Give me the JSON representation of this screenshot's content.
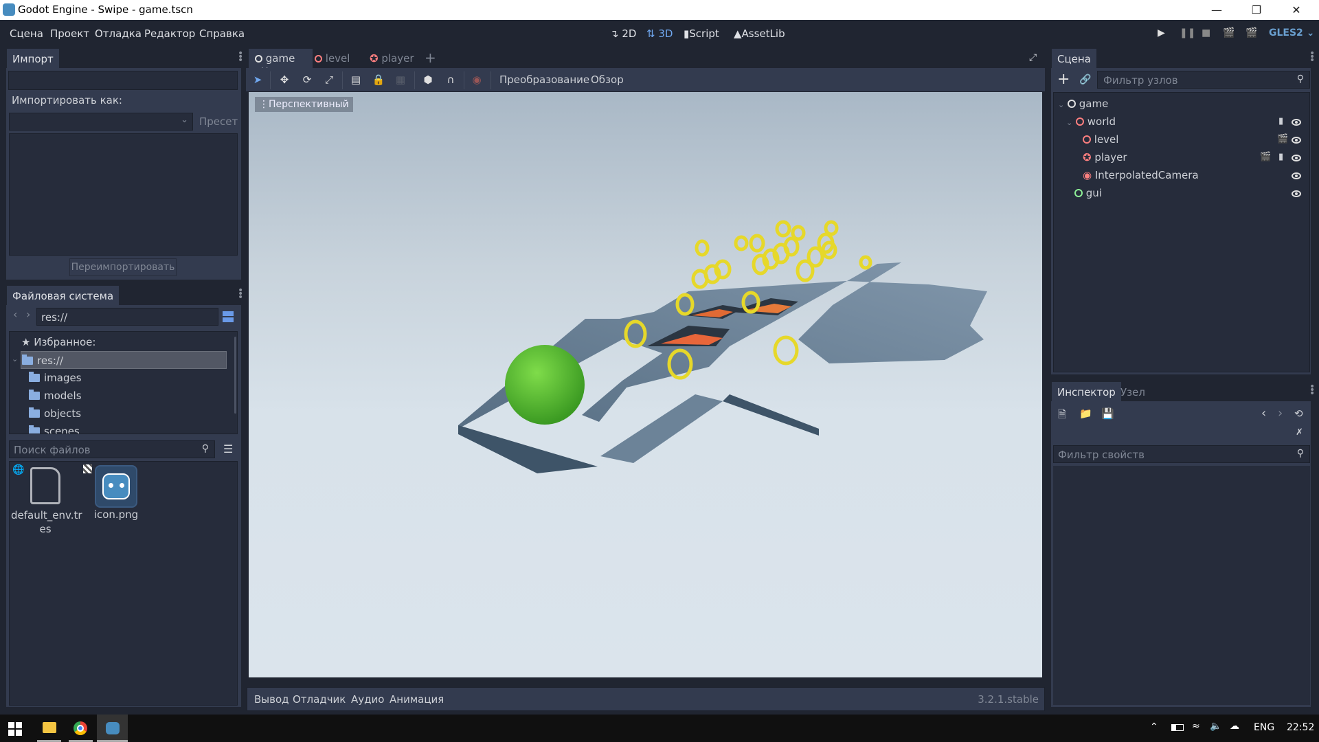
{
  "window": {
    "title": "Godot Engine - Swipe - game.tscn",
    "controls": [
      "minimize",
      "restore",
      "close"
    ]
  },
  "menu": [
    "Сцена",
    "Проект",
    "Отладка",
    "Редактор",
    "Справка"
  ],
  "modes": [
    {
      "label": "2D",
      "icon": "2d-axes-icon",
      "active": false
    },
    {
      "label": "3D",
      "icon": "3d-axes-icon",
      "active": true
    },
    {
      "label": "Script",
      "icon": "script-icon",
      "active": false
    },
    {
      "label": "AssetLib",
      "icon": "assetlib-icon",
      "active": false
    }
  ],
  "renderer": "GLES2",
  "import_dock": {
    "tab": "Импорт",
    "import_as_label": "Импортировать как:",
    "preset_label": "Пресет",
    "reimport_label": "Переимпортировать"
  },
  "filesystem_dock": {
    "tab": "Файловая система",
    "path": "res://",
    "favorites_label": "Избранное:",
    "root": "res://",
    "folders": [
      "images",
      "models",
      "objects",
      "scenes"
    ],
    "search_placeholder": "Поиск файлов",
    "files": [
      {
        "name": "default_env.tres",
        "line1": "default_env.tr",
        "line2": "es",
        "icon": "file-icon"
      },
      {
        "name": "icon.png",
        "line1": "icon.png",
        "line2": "",
        "icon": "godot-logo-icon"
      }
    ]
  },
  "scene_tabs": [
    {
      "label": "game",
      "active": true,
      "closable": true
    },
    {
      "label": "level",
      "active": false
    },
    {
      "label": "player",
      "active": false
    }
  ],
  "viewport_toolbar": {
    "transform_label": "Преобразование",
    "view_label": "Обзор",
    "perspective_label": "Перспективный"
  },
  "scene_dock": {
    "tab": "Сцена",
    "filter_placeholder": "Фильтр узлов",
    "nodes": [
      {
        "name": "game",
        "depth": 0,
        "color": "#e0e0e0",
        "type": "spatial",
        "icons": [
          "visibility"
        ]
      },
      {
        "name": "world",
        "depth": 1,
        "color": "#fc9c9c",
        "type": "spatial",
        "icons": [
          "script",
          "visibility"
        ]
      },
      {
        "name": "level",
        "depth": 2,
        "color": "#fc9c9c",
        "type": "spatial",
        "icons": [
          "instance",
          "visibility"
        ]
      },
      {
        "name": "player",
        "depth": 2,
        "color": "#fc9c9c",
        "type": "body",
        "icons": [
          "instance",
          "script",
          "visibility"
        ]
      },
      {
        "name": "InterpolatedCamera",
        "depth": 2,
        "color": "#fc9c9c",
        "type": "camera",
        "icons": [
          "visibility"
        ]
      },
      {
        "name": "gui",
        "depth": 1,
        "color": "#a5efac",
        "type": "control",
        "icons": [
          "visibility"
        ]
      }
    ]
  },
  "inspector_dock": {
    "tabs": [
      "Инспектор",
      "Узел"
    ],
    "filter_placeholder": "Фильтр свойств"
  },
  "bottom_panel": {
    "tabs": [
      "Вывод",
      "Отладчик",
      "Аудио",
      "Анимация"
    ],
    "version": "3.2.1.stable"
  },
  "taskbar": {
    "lang": "ENG",
    "time": "22:52"
  }
}
